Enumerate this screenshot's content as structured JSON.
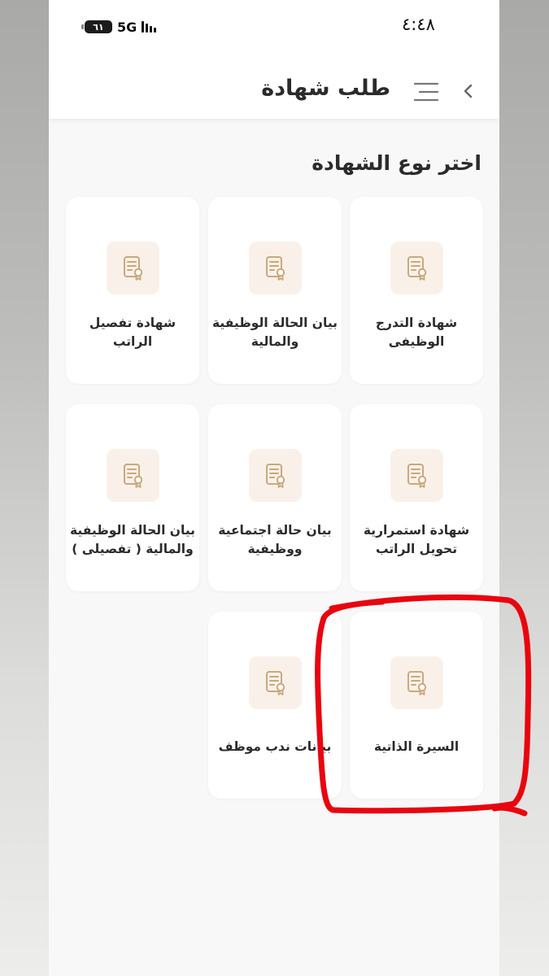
{
  "status_bar": {
    "time": "٤:٤٨",
    "network": "5G",
    "battery": "٦١"
  },
  "header": {
    "title": "طلب شهادة"
  },
  "section": {
    "title": "اختر نوع الشهادة"
  },
  "certificates": [
    {
      "label": "شهادة التدرج الوظيفى",
      "icon": "certificate-icon"
    },
    {
      "label": "بيان الحالة الوظيفية والمالية",
      "icon": "certificate-icon"
    },
    {
      "label": "شهادة تفصيل الراتب",
      "icon": "certificate-icon"
    },
    {
      "label": "شهادة استمرارية تحويل الراتب",
      "icon": "certificate-icon"
    },
    {
      "label": "بيان حالة اجتماعية ووظيفية",
      "icon": "certificate-icon"
    },
    {
      "label": "بيان الحالة الوظيفية والمالية ( تفصيلى )",
      "icon": "certificate-icon"
    },
    {
      "label": "السيرة الذاتية",
      "icon": "certificate-icon"
    },
    {
      "label": "بيانات ندب موظف",
      "icon": "certificate-icon"
    }
  ],
  "colors": {
    "icon_accent": "#c9a97c",
    "icon_bg": "#f9f1e9",
    "highlight": "#e8050f"
  }
}
